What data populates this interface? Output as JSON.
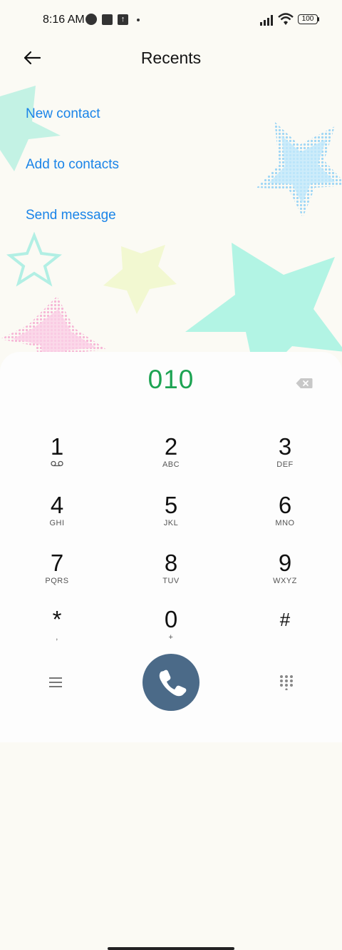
{
  "status_bar": {
    "time": "8:16 AM",
    "battery": "100",
    "icons": [
      "notification-icon",
      "app-icon",
      "upload-icon",
      "dot-icon",
      "signal-icon",
      "wifi-icon",
      "battery-icon"
    ]
  },
  "header": {
    "title": "Recents",
    "back_icon": "back-arrow-icon"
  },
  "actions": [
    "New contact",
    "Add to contacts",
    "Send message"
  ],
  "dialer": {
    "number": "010",
    "keys": [
      {
        "digit": "1",
        "letters": "voicemail-icon"
      },
      {
        "digit": "2",
        "letters": "ABC"
      },
      {
        "digit": "3",
        "letters": "DEF"
      },
      {
        "digit": "4",
        "letters": "GHI"
      },
      {
        "digit": "5",
        "letters": "JKL"
      },
      {
        "digit": "6",
        "letters": "MNO"
      },
      {
        "digit": "7",
        "letters": "PQRS"
      },
      {
        "digit": "8",
        "letters": "TUV"
      },
      {
        "digit": "9",
        "letters": "WXYZ"
      },
      {
        "digit": "*",
        "letters": ","
      },
      {
        "digit": "0",
        "letters": "+"
      },
      {
        "digit": "#",
        "letters": ""
      }
    ]
  },
  "colors": {
    "accent_blue": "#1a84e8",
    "number_green": "#1ca352",
    "call_button": "#4b6a88"
  }
}
